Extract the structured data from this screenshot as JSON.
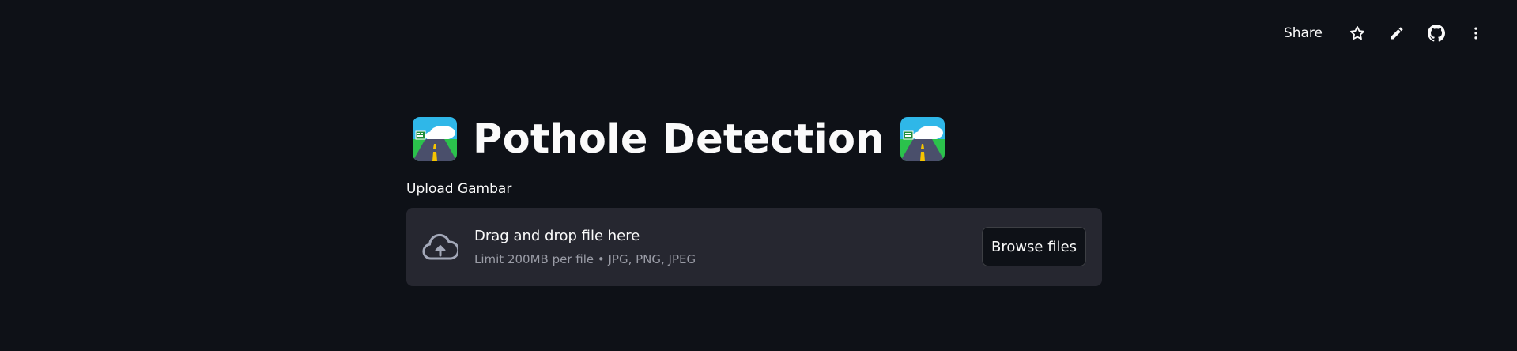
{
  "toolbar": {
    "share_label": "Share",
    "icons": [
      "star-icon",
      "pencil-icon",
      "github-icon",
      "more-vertical-icon"
    ]
  },
  "header": {
    "title": "Pothole Detection",
    "emoji": "motorway-emoji"
  },
  "uploader": {
    "label": "Upload Gambar",
    "drop_text": "Drag and drop file here",
    "limit_text": "Limit 200MB per file • JPG, PNG, JPEG",
    "button_label": "Browse files"
  },
  "colors": {
    "background": "#0e1117",
    "dropzone": "#262730",
    "text": "#fafafa",
    "muted_text": "#9a9ca6"
  }
}
